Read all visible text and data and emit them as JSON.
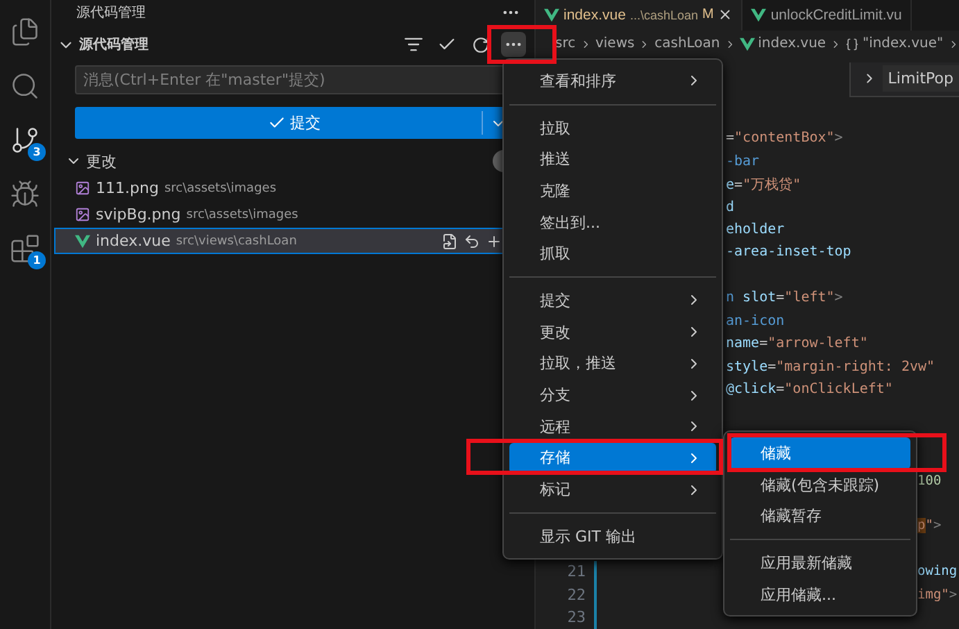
{
  "activity_bar": [
    {
      "kind": "files",
      "selected": false
    },
    {
      "kind": "search",
      "selected": false
    },
    {
      "kind": "source_control",
      "selected": true,
      "badge": "3"
    },
    {
      "kind": "run",
      "selected": false
    },
    {
      "kind": "extensions",
      "selected": false,
      "badge": "1"
    }
  ],
  "sidebar": {
    "title": "源代码管理",
    "section": {
      "title": "源代码管理",
      "expanded": true
    },
    "commit_message": {
      "placeholder": "消息(Ctrl+Enter 在\"master\"提交)"
    },
    "commit_button": {
      "label": "提交"
    },
    "changes": {
      "title": "更改",
      "expanded": true,
      "files": [
        {
          "name": "111.png",
          "path": "src\\assets\\images",
          "kind": "image",
          "selected": false
        },
        {
          "name": "svipBg.png",
          "path": "src\\assets\\images",
          "kind": "image",
          "selected": false
        },
        {
          "name": "index.vue",
          "path": "src\\views\\cashLoan",
          "kind": "vue",
          "selected": true
        }
      ]
    }
  },
  "tabs": [
    {
      "label": "index.vue",
      "description": "...\\cashLoan",
      "status": "M",
      "selected": true
    },
    {
      "label": "unlockCreditLimit.vu",
      "selected": false
    }
  ],
  "breadcrumbs": [
    {
      "label": "src",
      "kind": "folder"
    },
    {
      "label": "views",
      "kind": "folder"
    },
    {
      "label": "cashLoan",
      "kind": "folder"
    },
    {
      "label": "index.vue",
      "kind": "vue"
    },
    {
      "label": "\"index.vue\"",
      "kind": "symbol"
    }
  ],
  "outline_popup": {
    "label": "LimitPop"
  },
  "code_lines": [
    {
      "kind": "mid",
      "segments": [
        {
          "text": "=",
          "kind": "punct"
        },
        {
          "text": "\"contentBox\"",
          "kind": "str"
        },
        {
          "text": ">",
          "kind": "bracket"
        }
      ]
    },
    {
      "kind": "mid",
      "segments": [
        {
          "text": "-bar",
          "kind": "tag"
        }
      ]
    },
    {
      "kind": "mid",
      "segments": [
        {
          "text": "e",
          "kind": "attr"
        },
        {
          "text": "=",
          "kind": "punct"
        },
        {
          "text": "\"万栈贷\"",
          "kind": "str"
        }
      ]
    },
    {
      "kind": "mid",
      "segments": [
        {
          "text": "d",
          "kind": "attr"
        }
      ]
    },
    {
      "kind": "mid",
      "segments": [
        {
          "text": "eholder",
          "kind": "attr"
        }
      ]
    },
    {
      "kind": "mid",
      "segments": [
        {
          "text": "-area-inset-top",
          "kind": "attr"
        }
      ]
    },
    {
      "kind": "blank"
    },
    {
      "kind": "mid",
      "segments": [
        {
          "text": "n",
          "kind": "tag"
        },
        {
          "text": " slot",
          "kind": "attr"
        },
        {
          "text": "=",
          "kind": "punct"
        },
        {
          "text": "\"left\"",
          "kind": "str"
        },
        {
          "text": ">",
          "kind": "bracket"
        }
      ]
    },
    {
      "kind": "mid",
      "segments": [
        {
          "text": "an-icon",
          "kind": "tag"
        }
      ]
    },
    {
      "kind": "mid",
      "segments": [
        {
          "text": "name",
          "kind": "attr"
        },
        {
          "text": "=",
          "kind": "punct"
        },
        {
          "text": "\"arrow-left\"",
          "kind": "str"
        }
      ]
    },
    {
      "kind": "mid",
      "segments": [
        {
          "text": "style",
          "kind": "attr"
        },
        {
          "text": "=",
          "kind": "punct"
        },
        {
          "text": "\"margin-right: 2vw\"",
          "kind": "str"
        }
      ]
    },
    {
      "kind": "mid",
      "segments": [
        {
          "text": "@click",
          "kind": "attr"
        },
        {
          "text": "=",
          "kind": "punct"
        },
        {
          "text": "\"onClickLeft\"",
          "kind": "str"
        }
      ]
    },
    {
      "kind": "blank"
    },
    {
      "kind": "blank"
    },
    {
      "kind": "blank"
    },
    {
      "kind": "far",
      "segments": [
        {
          "text": "100",
          "kind": "num"
        }
      ]
    },
    {
      "kind": "blank"
    },
    {
      "kind": "far",
      "segments": [
        {
          "text": "p",
          "kind": "match"
        },
        {
          "text": "\"",
          "kind": "str"
        },
        {
          "text": ">",
          "kind": "bracket"
        }
      ]
    },
    {
      "kind": "blank"
    },
    {
      "kind": "far",
      "line": "21",
      "modified": true,
      "segments": [
        {
          "text": "owing",
          "kind": "attr"
        }
      ]
    },
    {
      "kind": "far",
      "line": "22",
      "modified": true,
      "segments": [
        {
          "text": "img",
          "kind": "str"
        },
        {
          "text": "\"",
          "kind": "str"
        },
        {
          "text": ">",
          "kind": "bracket"
        }
      ]
    },
    {
      "kind": "blank",
      "line": "23",
      "modified": true
    }
  ],
  "context_menu": {
    "groups": [
      [
        {
          "label": "查看和排序",
          "submenu": true,
          "selected": false
        }
      ],
      [
        {
          "label": "拉取",
          "submenu": false,
          "selected": false
        },
        {
          "label": "推送",
          "submenu": false,
          "selected": false
        },
        {
          "label": "克隆",
          "submenu": false,
          "selected": false
        },
        {
          "label": "签出到...",
          "submenu": false,
          "selected": false
        },
        {
          "label": "抓取",
          "submenu": false,
          "selected": false
        }
      ],
      [
        {
          "label": "提交",
          "submenu": true,
          "selected": false
        },
        {
          "label": "更改",
          "submenu": true,
          "selected": false
        },
        {
          "label": "拉取，推送",
          "submenu": true,
          "selected": false
        },
        {
          "label": "分支",
          "submenu": true,
          "selected": false
        },
        {
          "label": "远程",
          "submenu": true,
          "selected": false
        },
        {
          "label": "存储",
          "submenu": true,
          "selected": true
        },
        {
          "label": "标记",
          "submenu": true,
          "selected": false
        }
      ],
      [
        {
          "label": "显示 GIT 输出",
          "submenu": false,
          "selected": false
        }
      ]
    ]
  },
  "stash_submenu": {
    "groups": [
      [
        {
          "label": "储藏",
          "selected": true
        },
        {
          "label": "储藏(包含未跟踪)",
          "selected": false
        },
        {
          "label": "储藏暂存",
          "selected": false
        }
      ],
      [
        {
          "label": "应用最新储藏",
          "selected": false
        },
        {
          "label": "应用储藏...",
          "selected": false
        }
      ]
    ]
  }
}
